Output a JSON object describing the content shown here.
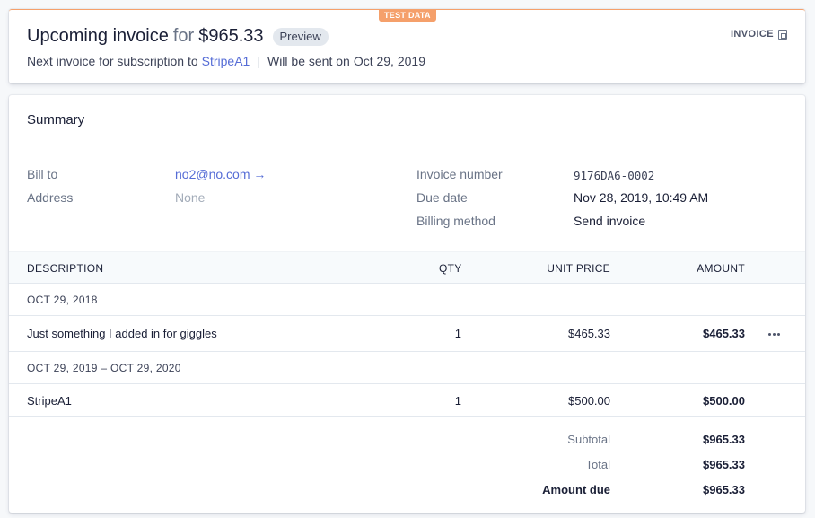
{
  "header": {
    "test_badge": "TEST DATA",
    "title_main": "Upcoming invoice",
    "title_for": "for",
    "title_amount": "$965.33",
    "preview_badge": "Preview",
    "subtitle_prefix": "Next invoice for subscription to",
    "subscription_link": "StripeA1",
    "separator": "|",
    "sent_prefix": "Will be sent on",
    "sent_date": "Oct 29, 2019",
    "invoice_button": "INVOICE",
    "invoice_icon": "pdf-icon"
  },
  "summary": {
    "title": "Summary",
    "bill_to_label": "Bill to",
    "bill_to_value": "no2@no.com",
    "bill_to_arrow": "→",
    "address_label": "Address",
    "address_value": "None",
    "invoice_number_label": "Invoice number",
    "invoice_number_value": "9176DA6-0002",
    "due_date_label": "Due date",
    "due_date_value": "Nov 28, 2019, 10:49 AM",
    "billing_method_label": "Billing method",
    "billing_method_value": "Send invoice"
  },
  "table": {
    "headers": {
      "description": "DESCRIPTION",
      "qty": "QTY",
      "unit_price": "UNIT PRICE",
      "amount": "AMOUNT"
    },
    "groups": [
      {
        "period": "OCT 29, 2018",
        "item": {
          "description": "Just something I added in for giggles",
          "qty": "1",
          "unit_price": "$465.33",
          "amount": "$465.33"
        }
      },
      {
        "period": "OCT 29, 2019 – OCT 29, 2020",
        "item": {
          "description": "StripeA1",
          "qty": "1",
          "unit_price": "$500.00",
          "amount": "$500.00"
        }
      }
    ]
  },
  "totals": {
    "subtotal_label": "Subtotal",
    "subtotal_value": "$965.33",
    "total_label": "Total",
    "total_value": "$965.33",
    "amount_due_label": "Amount due",
    "amount_due_value": "$965.33"
  },
  "colors": {
    "accent_link": "#556cd6",
    "test_badge": "#f5a06b",
    "preview_badge_bg": "#e3e8ee"
  }
}
